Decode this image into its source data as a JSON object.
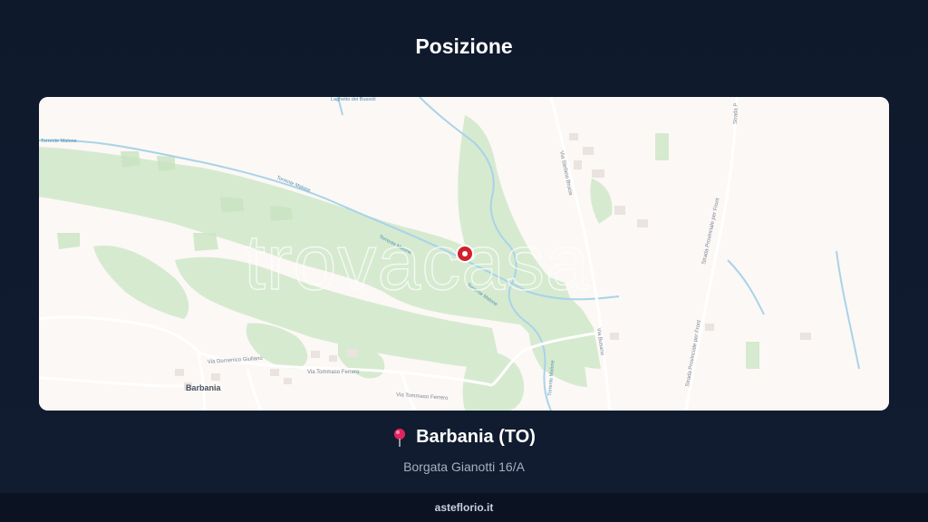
{
  "section": {
    "title": "Posizione"
  },
  "map": {
    "watermark": "trovacasa",
    "labels": {
      "town": "Barbania",
      "road_domenico_giuliano": "Via Domenico Giuliano",
      "road_tommaso_ferrero_1": "Via Tommaso Ferrero",
      "road_tommaso_ferrero_2": "Via Tommaso Ferrero",
      "road_stefano_brucia": "Via Stefano Brucia",
      "road_busano": "Via Busano",
      "road_provinciale_1": "Strada Provinciale per Front",
      "road_provinciale_2": "Strada Provinciale per Front",
      "road_provinciale_3": "Strada P",
      "water_1": "Torrente Malone",
      "water_2": "Torrente Malone",
      "water_3": "Torrente Malone",
      "water_4": "Torrente Malone",
      "water_5": "Torrente Malone",
      "water_lake": "Laghetto dei Bussoli"
    },
    "colors": {
      "land": "#fcf8f5",
      "forest": "#d4e9cc",
      "water": "#a9d3e9",
      "road": "#ffffff",
      "marker": "#d0212c"
    }
  },
  "location": {
    "pin_icon": "map-pin-icon",
    "name": "Barbania (TO)",
    "address": "Borgata Gianotti 16/A"
  },
  "footer": {
    "site": "asteflorio.it"
  }
}
